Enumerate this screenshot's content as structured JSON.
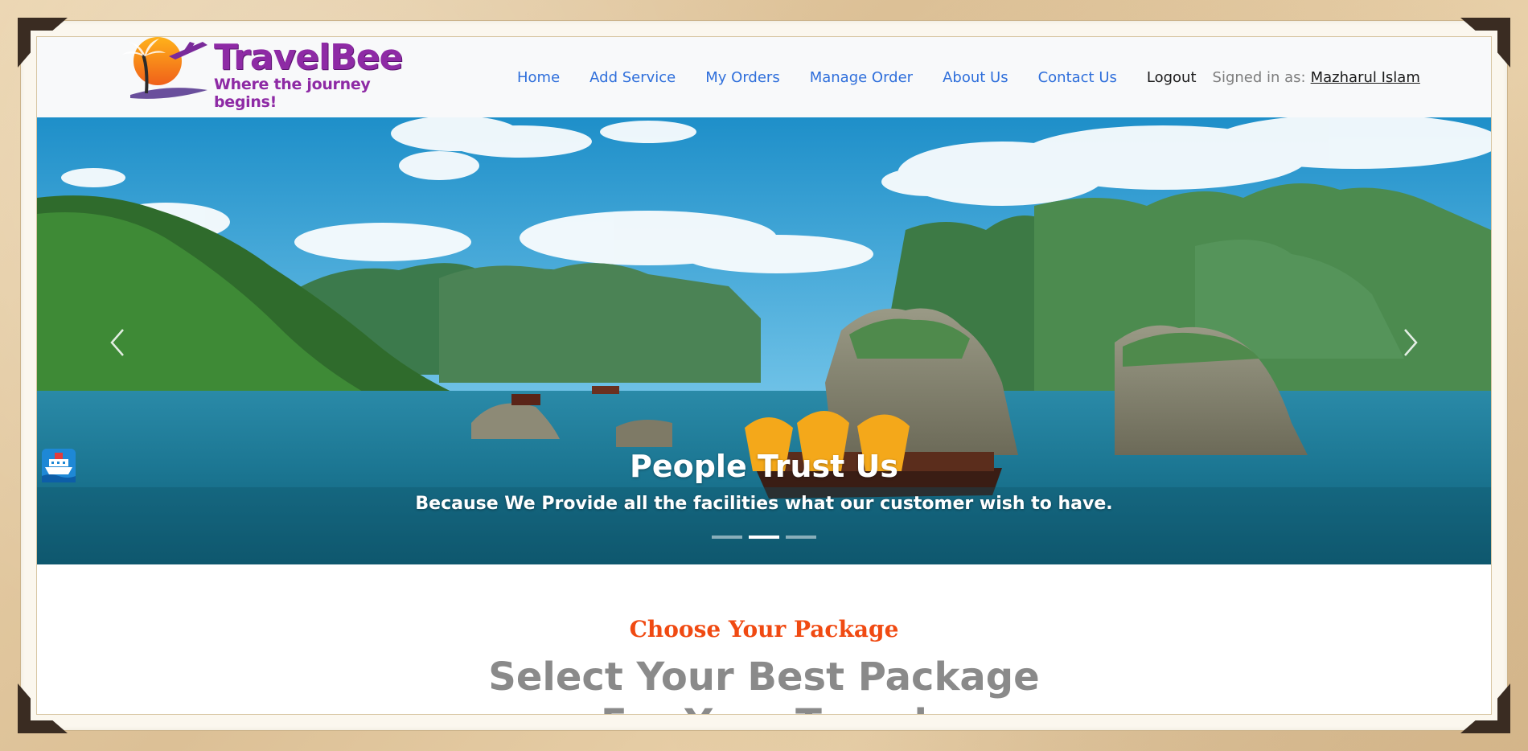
{
  "brand": {
    "name": "TravelBee",
    "tagline": "Where the journey begins!"
  },
  "nav": {
    "items": [
      {
        "label": "Home"
      },
      {
        "label": "Add Service"
      },
      {
        "label": "My Orders"
      },
      {
        "label": "Manage Order"
      },
      {
        "label": "About Us"
      },
      {
        "label": "Contact Us"
      }
    ],
    "logout_label": "Logout",
    "signed_in_label": "Signed in as:",
    "user_name": "Mazharul Islam"
  },
  "carousel": {
    "title": "People Trust Us",
    "text": "Because We Provide all the facilities what our customer wish to have.",
    "slide_count": 3,
    "active_index": 1,
    "prev_icon": "chevron-left-icon",
    "next_icon": "chevron-right-icon",
    "title_icon": "ship-icon"
  },
  "packages": {
    "eyebrow": "Choose Your Package",
    "heading_line1": "Select Your Best Package",
    "heading_line2": "For Your Travel"
  },
  "colors": {
    "nav_link": "#2f6fdb",
    "brand_purple": "#8e2aa5",
    "accent_orange": "#f04a12",
    "heading_gray": "#8a8a8a"
  }
}
